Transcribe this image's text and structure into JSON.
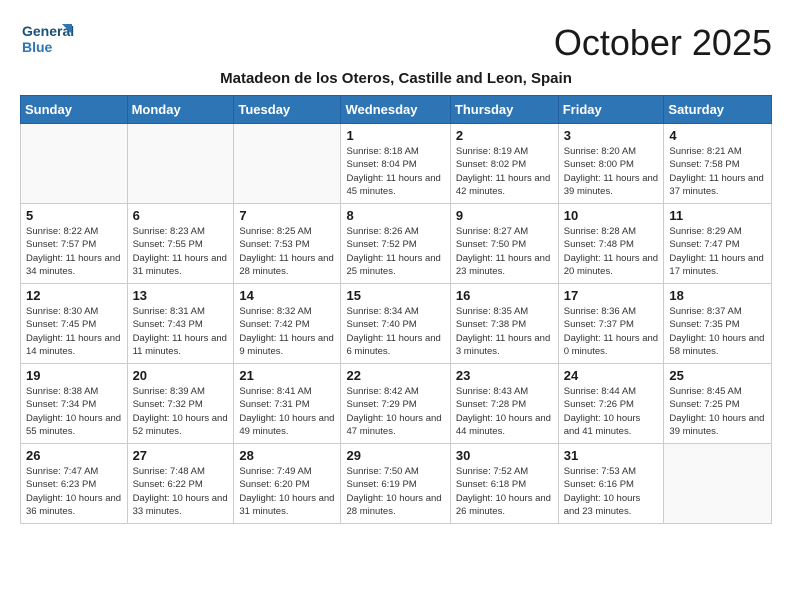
{
  "header": {
    "logo_line1": "General",
    "logo_line2": "Blue",
    "month_title": "October 2025",
    "subtitle": "Matadeon de los Oteros, Castille and Leon, Spain"
  },
  "weekdays": [
    "Sunday",
    "Monday",
    "Tuesday",
    "Wednesday",
    "Thursday",
    "Friday",
    "Saturday"
  ],
  "weeks": [
    [
      {
        "day": "",
        "info": ""
      },
      {
        "day": "",
        "info": ""
      },
      {
        "day": "",
        "info": ""
      },
      {
        "day": "1",
        "info": "Sunrise: 8:18 AM\nSunset: 8:04 PM\nDaylight: 11 hours\nand 45 minutes."
      },
      {
        "day": "2",
        "info": "Sunrise: 8:19 AM\nSunset: 8:02 PM\nDaylight: 11 hours\nand 42 minutes."
      },
      {
        "day": "3",
        "info": "Sunrise: 8:20 AM\nSunset: 8:00 PM\nDaylight: 11 hours\nand 39 minutes."
      },
      {
        "day": "4",
        "info": "Sunrise: 8:21 AM\nSunset: 7:58 PM\nDaylight: 11 hours\nand 37 minutes."
      }
    ],
    [
      {
        "day": "5",
        "info": "Sunrise: 8:22 AM\nSunset: 7:57 PM\nDaylight: 11 hours\nand 34 minutes."
      },
      {
        "day": "6",
        "info": "Sunrise: 8:23 AM\nSunset: 7:55 PM\nDaylight: 11 hours\nand 31 minutes."
      },
      {
        "day": "7",
        "info": "Sunrise: 8:25 AM\nSunset: 7:53 PM\nDaylight: 11 hours\nand 28 minutes."
      },
      {
        "day": "8",
        "info": "Sunrise: 8:26 AM\nSunset: 7:52 PM\nDaylight: 11 hours\nand 25 minutes."
      },
      {
        "day": "9",
        "info": "Sunrise: 8:27 AM\nSunset: 7:50 PM\nDaylight: 11 hours\nand 23 minutes."
      },
      {
        "day": "10",
        "info": "Sunrise: 8:28 AM\nSunset: 7:48 PM\nDaylight: 11 hours\nand 20 minutes."
      },
      {
        "day": "11",
        "info": "Sunrise: 8:29 AM\nSunset: 7:47 PM\nDaylight: 11 hours\nand 17 minutes."
      }
    ],
    [
      {
        "day": "12",
        "info": "Sunrise: 8:30 AM\nSunset: 7:45 PM\nDaylight: 11 hours\nand 14 minutes."
      },
      {
        "day": "13",
        "info": "Sunrise: 8:31 AM\nSunset: 7:43 PM\nDaylight: 11 hours\nand 11 minutes."
      },
      {
        "day": "14",
        "info": "Sunrise: 8:32 AM\nSunset: 7:42 PM\nDaylight: 11 hours\nand 9 minutes."
      },
      {
        "day": "15",
        "info": "Sunrise: 8:34 AM\nSunset: 7:40 PM\nDaylight: 11 hours\nand 6 minutes."
      },
      {
        "day": "16",
        "info": "Sunrise: 8:35 AM\nSunset: 7:38 PM\nDaylight: 11 hours\nand 3 minutes."
      },
      {
        "day": "17",
        "info": "Sunrise: 8:36 AM\nSunset: 7:37 PM\nDaylight: 11 hours\nand 0 minutes."
      },
      {
        "day": "18",
        "info": "Sunrise: 8:37 AM\nSunset: 7:35 PM\nDaylight: 10 hours\nand 58 minutes."
      }
    ],
    [
      {
        "day": "19",
        "info": "Sunrise: 8:38 AM\nSunset: 7:34 PM\nDaylight: 10 hours\nand 55 minutes."
      },
      {
        "day": "20",
        "info": "Sunrise: 8:39 AM\nSunset: 7:32 PM\nDaylight: 10 hours\nand 52 minutes."
      },
      {
        "day": "21",
        "info": "Sunrise: 8:41 AM\nSunset: 7:31 PM\nDaylight: 10 hours\nand 49 minutes."
      },
      {
        "day": "22",
        "info": "Sunrise: 8:42 AM\nSunset: 7:29 PM\nDaylight: 10 hours\nand 47 minutes."
      },
      {
        "day": "23",
        "info": "Sunrise: 8:43 AM\nSunset: 7:28 PM\nDaylight: 10 hours\nand 44 minutes."
      },
      {
        "day": "24",
        "info": "Sunrise: 8:44 AM\nSunset: 7:26 PM\nDaylight: 10 hours\nand 41 minutes."
      },
      {
        "day": "25",
        "info": "Sunrise: 8:45 AM\nSunset: 7:25 PM\nDaylight: 10 hours\nand 39 minutes."
      }
    ],
    [
      {
        "day": "26",
        "info": "Sunrise: 7:47 AM\nSunset: 6:23 PM\nDaylight: 10 hours\nand 36 minutes."
      },
      {
        "day": "27",
        "info": "Sunrise: 7:48 AM\nSunset: 6:22 PM\nDaylight: 10 hours\nand 33 minutes."
      },
      {
        "day": "28",
        "info": "Sunrise: 7:49 AM\nSunset: 6:20 PM\nDaylight: 10 hours\nand 31 minutes."
      },
      {
        "day": "29",
        "info": "Sunrise: 7:50 AM\nSunset: 6:19 PM\nDaylight: 10 hours\nand 28 minutes."
      },
      {
        "day": "30",
        "info": "Sunrise: 7:52 AM\nSunset: 6:18 PM\nDaylight: 10 hours\nand 26 minutes."
      },
      {
        "day": "31",
        "info": "Sunrise: 7:53 AM\nSunset: 6:16 PM\nDaylight: 10 hours\nand 23 minutes."
      },
      {
        "day": "",
        "info": ""
      }
    ]
  ]
}
